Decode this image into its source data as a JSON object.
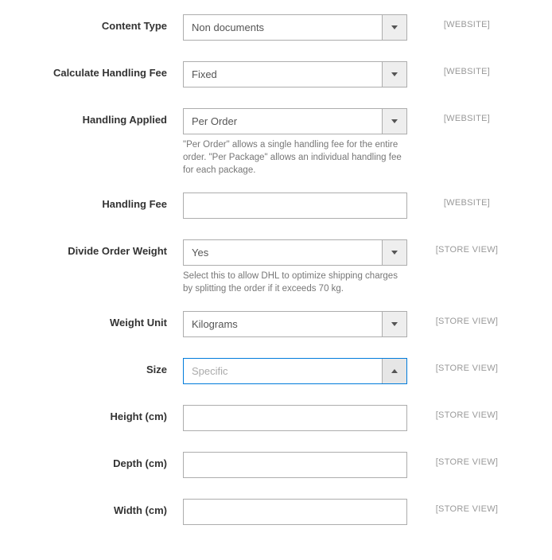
{
  "fields": {
    "content_type": {
      "label": "Content Type",
      "value": "Non documents",
      "scope": "[WEBSITE]"
    },
    "calculate_handling_fee": {
      "label": "Calculate Handling Fee",
      "value": "Fixed",
      "scope": "[WEBSITE]"
    },
    "handling_applied": {
      "label": "Handling Applied",
      "value": "Per Order",
      "scope": "[WEBSITE]",
      "help": "\"Per Order\" allows a single handling fee for the entire order. \"Per Package\" allows an individual handling fee for each package."
    },
    "handling_fee": {
      "label": "Handling Fee",
      "value": "",
      "scope": "[WEBSITE]"
    },
    "divide_order_weight": {
      "label": "Divide Order Weight",
      "value": "Yes",
      "scope": "[STORE VIEW]",
      "help": "Select this to allow DHL to optimize shipping charges by splitting the order if it exceeds 70 kg."
    },
    "weight_unit": {
      "label": "Weight Unit",
      "value": "Kilograms",
      "scope": "[STORE VIEW]"
    },
    "size": {
      "label": "Size",
      "value": "Specific",
      "scope": "[STORE VIEW]"
    },
    "height": {
      "label": "Height (cm)",
      "value": "",
      "scope": "[STORE VIEW]"
    },
    "depth": {
      "label": "Depth (cm)",
      "value": "",
      "scope": "[STORE VIEW]"
    },
    "width": {
      "label": "Width (cm)",
      "value": "",
      "scope": "[STORE VIEW]"
    }
  }
}
